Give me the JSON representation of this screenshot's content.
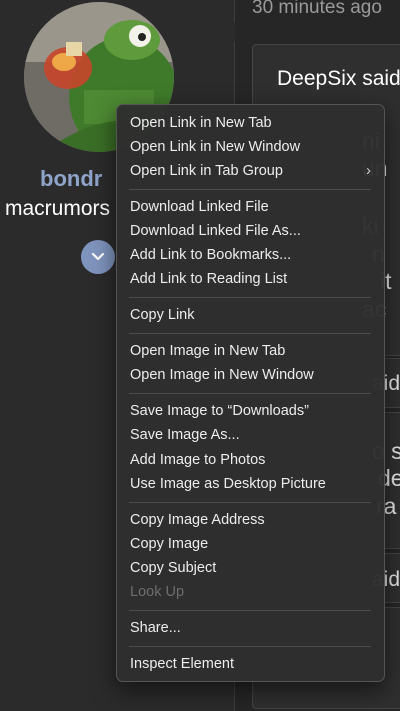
{
  "page": {
    "timestamp": "30 minutes ago"
  },
  "user": {
    "name": "bondr",
    "title": "macrumors"
  },
  "thread": {
    "quote_author": "DeepSix said",
    "peek_fragments": [
      "ni",
      "un",
      "ki",
      "n",
      "it",
      "ac",
      "aid",
      "o s",
      "de",
      "ra",
      "aid"
    ]
  },
  "context_menu": {
    "items": [
      {
        "label": "Open Link in New Tab",
        "enabled": true
      },
      {
        "label": "Open Link in New Window",
        "enabled": true
      },
      {
        "label": "Open Link in Tab Group",
        "enabled": true,
        "submenu": true
      },
      {
        "label": "Download Linked File",
        "enabled": true
      },
      {
        "label": "Download Linked File As...",
        "enabled": true
      },
      {
        "label": "Add Link to Bookmarks...",
        "enabled": true
      },
      {
        "label": "Add Link to Reading List",
        "enabled": true
      },
      {
        "label": "Copy Link",
        "enabled": true
      },
      {
        "label": "Open Image in New Tab",
        "enabled": true
      },
      {
        "label": "Open Image in New Window",
        "enabled": true
      },
      {
        "label": "Save Image to “Downloads”",
        "enabled": true
      },
      {
        "label": "Save Image As...",
        "enabled": true
      },
      {
        "label": "Add Image to Photos",
        "enabled": true
      },
      {
        "label": "Use Image as Desktop Picture",
        "enabled": true
      },
      {
        "label": "Copy Image Address",
        "enabled": true
      },
      {
        "label": "Copy Image",
        "enabled": true
      },
      {
        "label": "Copy Subject",
        "enabled": true
      },
      {
        "label": "Look Up",
        "enabled": false
      },
      {
        "label": "Share...",
        "enabled": true
      },
      {
        "label": "Inspect Element",
        "enabled": true
      }
    ]
  },
  "colors": {
    "username": "#8fa4c9",
    "expand_button": "#7f94bd",
    "menu_background": "#2e2e2e",
    "disabled_text": "#6d6d6d"
  },
  "icons": {
    "expand": "chevron-down-icon",
    "submenu": "chevron-right-icon"
  }
}
